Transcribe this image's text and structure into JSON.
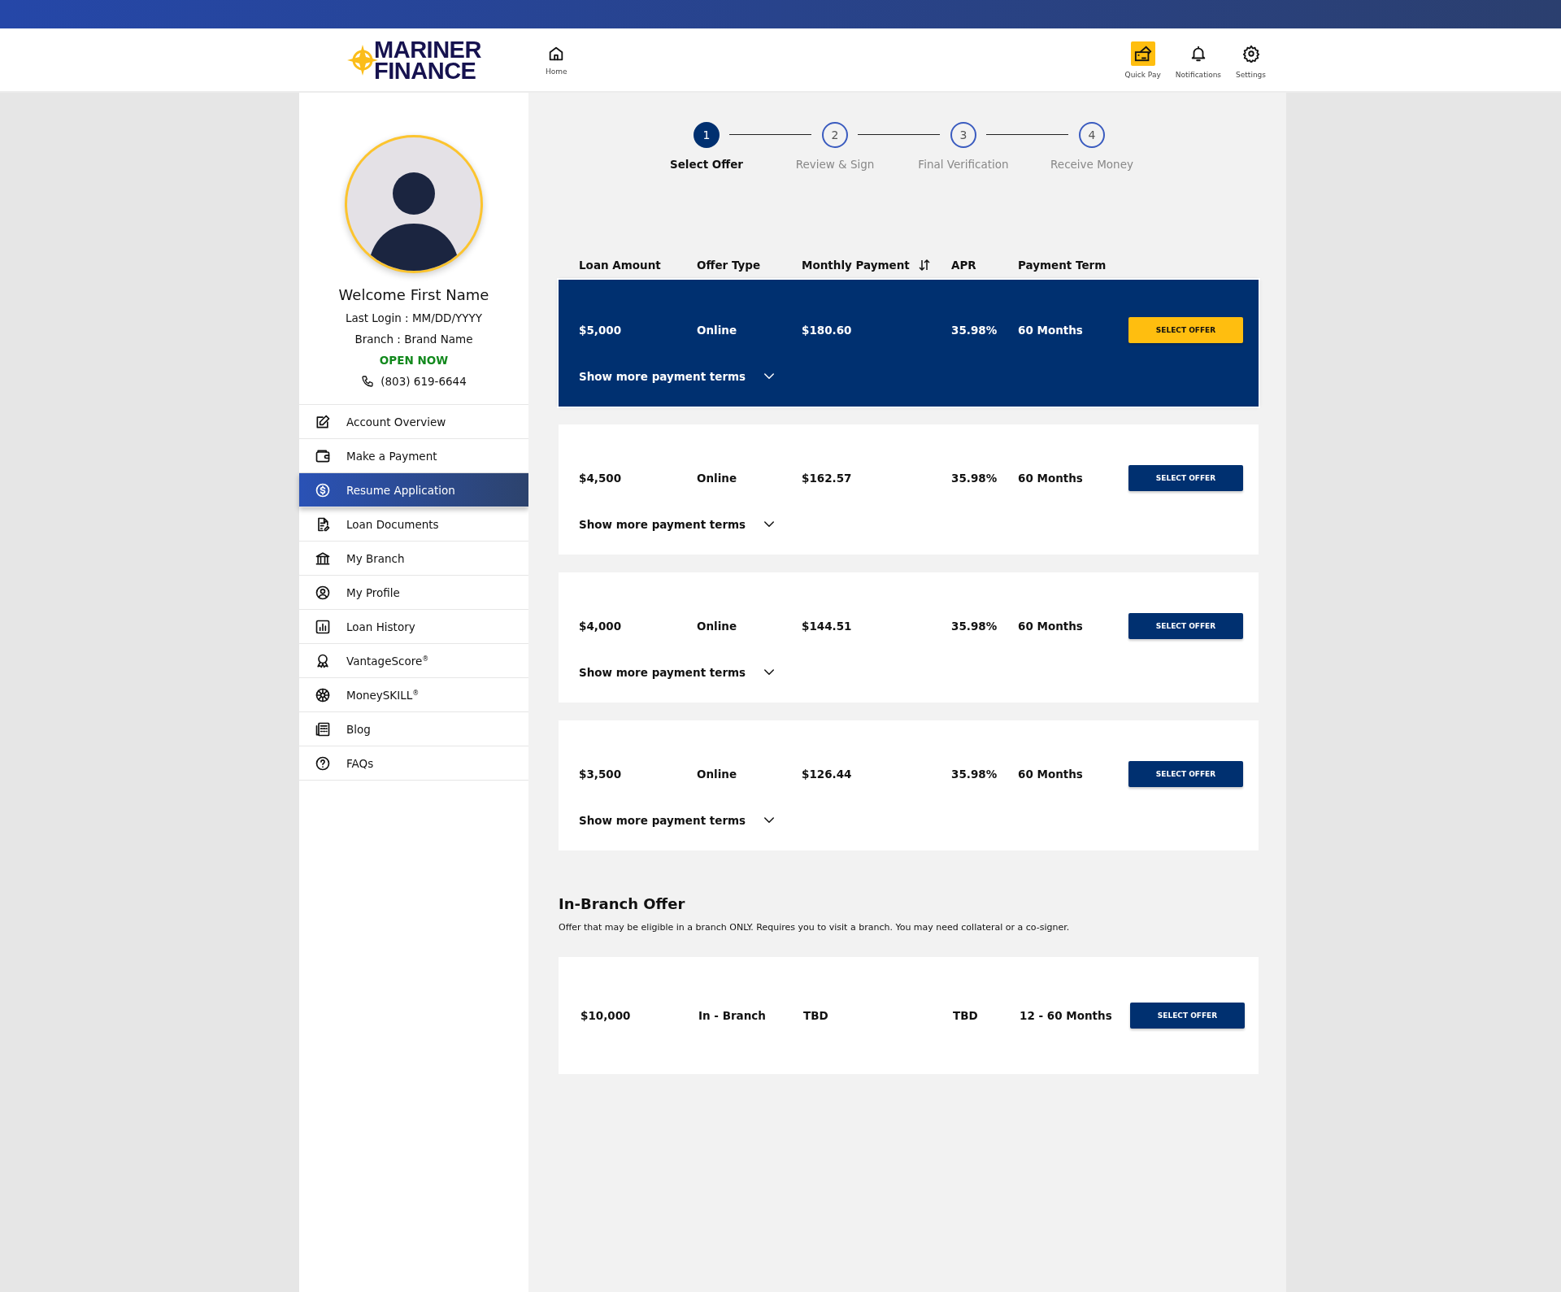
{
  "header": {
    "logo": [
      "MARINER",
      "FINANCE"
    ],
    "home": "Home",
    "actions": [
      {
        "label": "Quick Pay",
        "kind": "quickpay"
      },
      {
        "label": "Notifications",
        "kind": "bell"
      },
      {
        "label": "Settings",
        "kind": "gear"
      }
    ]
  },
  "profile": {
    "welcome": "Welcome First Name",
    "last_login": "Last Login : MM/DD/YYYY",
    "branch": "Branch : Brand Name",
    "status": "OPEN NOW",
    "phone": "(803) 619-6644"
  },
  "sidebar": {
    "items": [
      {
        "label": "Account Overview",
        "selected": false
      },
      {
        "label": "Make a Payment",
        "selected": false
      },
      {
        "label": "Resume Application",
        "selected": true
      },
      {
        "label": "Loan Documents",
        "selected": false
      },
      {
        "label": "My Branch",
        "selected": false
      },
      {
        "label": "My Profile",
        "selected": false
      },
      {
        "label": "Loan History",
        "selected": false
      },
      {
        "label": "VantageScore$^{®}$",
        "selected": false
      },
      {
        "label": "MoneySKILL$^{®}$",
        "selected": false
      },
      {
        "label": "Blog",
        "selected": false
      },
      {
        "label": "FAQs",
        "selected": false
      }
    ]
  },
  "stepper": [
    {
      "number": "1",
      "label": "Select Offer",
      "selected": true
    },
    {
      "number": "2",
      "label": "Review & Sign",
      "selected": false
    },
    {
      "number": "3",
      "label": "Final Verification",
      "selected": false
    },
    {
      "number": "4",
      "label": "Receive Money",
      "selected": false
    }
  ],
  "table": {
    "columns": [
      "Loan Amount",
      "Offer Type",
      "Monthly Payment",
      "APR",
      "Payment Term"
    ],
    "offers": [
      {
        "amount": "$5,000",
        "type": "Online",
        "payment": "$180.60",
        "apr": "35.98%",
        "term": "60 Months",
        "button": "SELECT OFFER",
        "more": "Show more payment terms",
        "selected": true
      },
      {
        "amount": "$4,500",
        "type": "Online",
        "payment": "$162.57",
        "apr": "35.98%",
        "term": "60 Months",
        "button": "SELECT OFFER",
        "more": "Show more payment terms",
        "selected": false
      },
      {
        "amount": "$4,000",
        "type": "Online",
        "payment": "$144.51",
        "apr": "35.98%",
        "term": "60 Months",
        "button": "SELECT OFFER",
        "more": "Show more payment terms",
        "selected": false
      },
      {
        "amount": "$3,500",
        "type": "Online",
        "payment": "$126.44",
        "apr": "35.98%",
        "term": "60 Months",
        "button": "SELECT OFFER",
        "more": "Show more payment terms",
        "selected": false
      }
    ]
  },
  "in_branch": {
    "title": "In-Branch Offer",
    "description": "Offer that may be eligible in a branch ONLY. Requires you to visit a branch. You may need collateral or a co-signer.",
    "offer": {
      "amount": "$10,000",
      "type": "In - Branch",
      "payment": "TBD",
      "apr": "TBD",
      "term": "12 - 60 Months",
      "button": "SELECT OFFER"
    }
  }
}
